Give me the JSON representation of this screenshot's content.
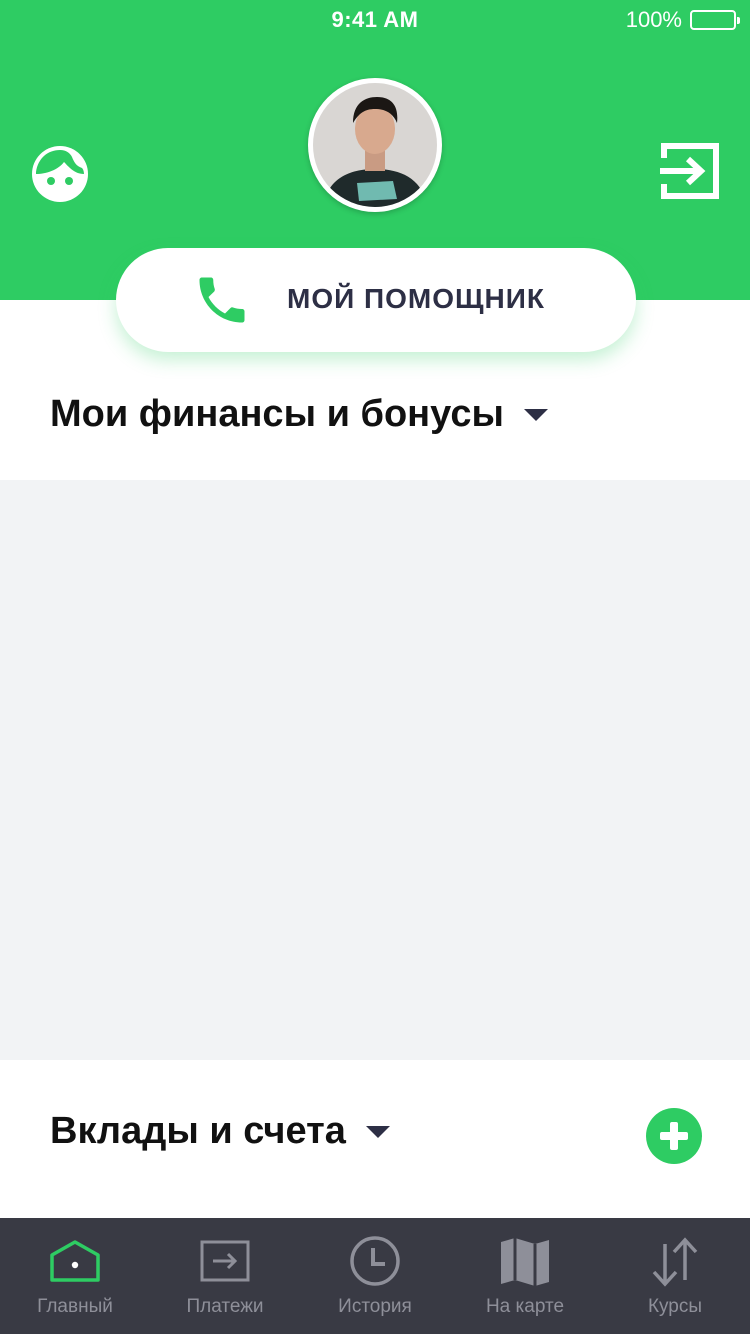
{
  "status_bar": {
    "time": "9:41 AM",
    "battery": "100%"
  },
  "header": {
    "profile_icon": "face-icon",
    "logout_icon": "logout-icon",
    "helper_button": {
      "label": "МОЙ ПОМОЩНИК",
      "icon": "phone-icon"
    }
  },
  "sections": {
    "finances": {
      "title": "Мои финансы и бонусы"
    },
    "deposits": {
      "title": "Вклады и счета",
      "add_icon": "plus-icon"
    }
  },
  "tab_bar": {
    "items": [
      {
        "label": "Главный",
        "icon": "home-icon",
        "active": true
      },
      {
        "label": "Платежи",
        "icon": "payments-icon",
        "active": false
      },
      {
        "label": "История",
        "icon": "clock-icon",
        "active": false
      },
      {
        "label": "На карте",
        "icon": "map-icon",
        "active": false
      },
      {
        "label": "Курсы",
        "icon": "exchange-icon",
        "active": false
      }
    ]
  },
  "colors": {
    "brand_green": "#2ecc63",
    "tab_bar": "#393a44",
    "tab_inactive": "#8e8f99",
    "dark_text": "#2d2f45"
  }
}
